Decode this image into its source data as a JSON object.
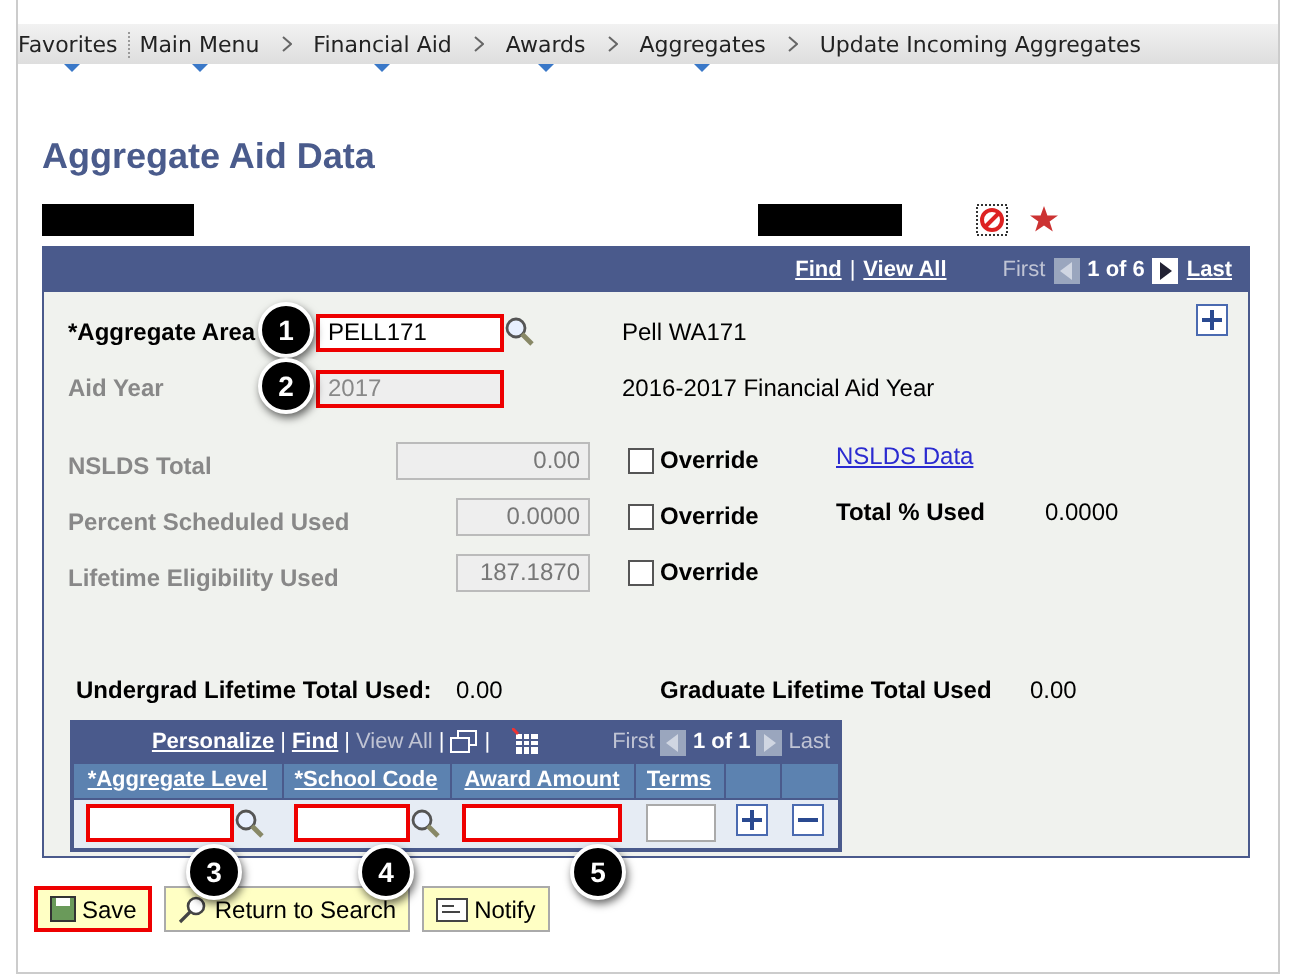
{
  "breadcrumb": [
    {
      "label": "Favorites",
      "menu": true
    },
    {
      "label": "Main Menu",
      "menu": true
    },
    {
      "label": "Financial Aid",
      "menu": true
    },
    {
      "label": "Awards",
      "menu": true
    },
    {
      "label": "Aggregates",
      "menu": true
    },
    {
      "label": "Update Incoming Aggregates",
      "menu": false
    }
  ],
  "title": "Aggregate Aid Data",
  "panel_nav": {
    "find": "Find",
    "separator": "|",
    "view_all": "View All",
    "first": "First",
    "first_disabled": true,
    "counter": "1 of 6",
    "last": "Last",
    "last_disabled": false
  },
  "key_fields": [
    {
      "label": "*Aggregate Area",
      "value": "PELL171",
      "description": "Pell WA171",
      "disabled": false,
      "highlighted": true,
      "callout": "1"
    },
    {
      "label": "Aid Year",
      "value": "2017",
      "description": "2016-2017 Financial Aid Year",
      "disabled": true,
      "highlighted": true,
      "callout": "2"
    }
  ],
  "totals": [
    {
      "label": "NSLDS Total",
      "value": "0.00",
      "override_label": "Override",
      "override": false,
      "extra": {
        "kind": "link",
        "text": "NSLDS Data"
      }
    },
    {
      "label": "Percent Scheduled Used",
      "value": "0.0000",
      "override_label": "Override",
      "override": false,
      "extra": {
        "kind": "pair",
        "text": "Total % Used",
        "value": "0.0000"
      }
    },
    {
      "label": "Lifetime Eligibility Used",
      "value": "187.1870",
      "override_label": "Override",
      "override": false
    }
  ],
  "lifetime": [
    {
      "label": "Undergrad Lifetime Total Used:",
      "value": "0.00"
    },
    {
      "label": "Graduate Lifetime Total Used",
      "value": "0.00"
    }
  ],
  "grid": {
    "nav": [
      {
        "text": "Personalize",
        "disabled": false
      },
      {
        "text": "Find",
        "disabled": false
      },
      {
        "text": "View All",
        "disabled": true
      }
    ],
    "separators": [
      "|",
      "|",
      "|",
      "|"
    ],
    "first": "First",
    "counter": "1 of 1",
    "last": "Last",
    "columns": [
      "*Aggregate Level",
      "*School Code",
      "Award Amount",
      "Terms"
    ],
    "cells": [
      {
        "kind": "lookup",
        "highlighted": true,
        "callout": "3"
      },
      {
        "kind": "lookup",
        "highlighted": true,
        "callout": "4"
      },
      {
        "kind": "input",
        "highlighted": true,
        "callout": "5"
      },
      {
        "kind": "input",
        "highlighted": false
      }
    ]
  },
  "buttons": [
    {
      "label": "Save",
      "kind": "save",
      "highlighted": true
    },
    {
      "label": "Return to Search",
      "kind": "search",
      "highlighted": false
    },
    {
      "label": "Notify",
      "kind": "notify",
      "highlighted": false
    }
  ]
}
